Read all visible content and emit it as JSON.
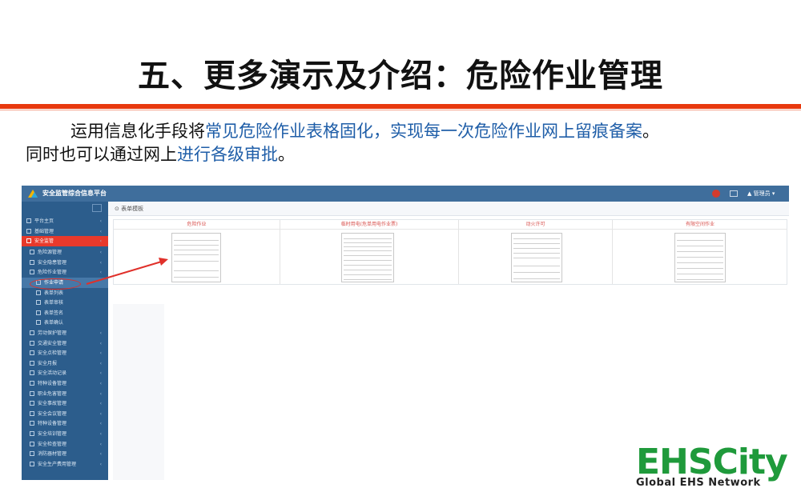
{
  "slide": {
    "title": "五、更多演示及介绍：危险作业管理",
    "intro_line1_plain": "运用信息化手段将",
    "intro_line1_hl": "常见危险作业表格固化，实现每一次危险作业网上留痕备案",
    "intro_line1_end": "。",
    "intro_line2_plain": "同时也可以通过网上",
    "intro_line2_hl": "进行各级审批",
    "intro_line2_end": "。"
  },
  "app": {
    "name": "安全监管综合信息平台",
    "user": "▲ 管理员 ▾",
    "breadcrumb": "⊙ 表单模板",
    "columns": [
      "危险作业",
      "临时用电(危单用电作业票)",
      "动火许可",
      "有限空间作业"
    ],
    "sidebar": [
      {
        "label": "平台主页",
        "level": "top",
        "state": ""
      },
      {
        "label": "基础管理",
        "level": "top",
        "state": ""
      },
      {
        "label": "安全监管",
        "level": "top",
        "state": "active"
      },
      {
        "label": "危险源管理",
        "level": "sub",
        "state": ""
      },
      {
        "label": "安全隐患管理",
        "level": "sub",
        "state": ""
      },
      {
        "label": "危险作业管理",
        "level": "sub",
        "state": ""
      },
      {
        "label": "作业申请",
        "level": "sub2",
        "state": "subactive"
      },
      {
        "label": "表单列表",
        "level": "sub2",
        "state": ""
      },
      {
        "label": "表单审核",
        "level": "sub2",
        "state": ""
      },
      {
        "label": "表单签名",
        "level": "sub2",
        "state": ""
      },
      {
        "label": "表单确认",
        "level": "sub2",
        "state": ""
      },
      {
        "label": "劳动保护管理",
        "level": "sub",
        "state": ""
      },
      {
        "label": "交通安全管理",
        "level": "sub",
        "state": ""
      },
      {
        "label": "安全点检管理",
        "level": "sub",
        "state": ""
      },
      {
        "label": "安全月报",
        "level": "sub",
        "state": ""
      },
      {
        "label": "安全活动记录",
        "level": "sub",
        "state": ""
      },
      {
        "label": "特种设备管理",
        "level": "sub",
        "state": ""
      },
      {
        "label": "职业危害管理",
        "level": "sub",
        "state": ""
      },
      {
        "label": "安全事故管理",
        "level": "sub",
        "state": ""
      },
      {
        "label": "安全会议管理",
        "level": "sub",
        "state": ""
      },
      {
        "label": "特种设备管理",
        "level": "sub",
        "state": ""
      },
      {
        "label": "安全培训管理",
        "level": "sub",
        "state": ""
      },
      {
        "label": "安全检查管理",
        "level": "sub",
        "state": ""
      },
      {
        "label": "消防器材管理",
        "level": "sub",
        "state": ""
      },
      {
        "label": "安全生产费用管理",
        "level": "sub",
        "state": ""
      }
    ]
  },
  "logo": {
    "main": "EHSCity",
    "sub": "Global EHS Network"
  },
  "colors": {
    "accent_red": "#e8390e",
    "highlight_blue": "#1f5ea8",
    "sidebar_bg": "#2c5d8c",
    "logo_green": "#1f9a3b"
  }
}
